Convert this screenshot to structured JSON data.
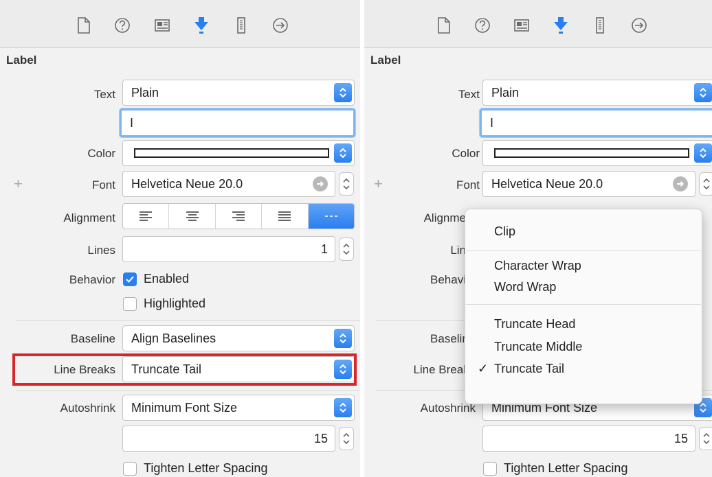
{
  "section_title": "Label",
  "labels": {
    "text": "Text",
    "color": "Color",
    "font": "Font",
    "alignment": "Alignment",
    "lines": "Lines",
    "behavior": "Behavior",
    "baseline": "Baseline",
    "line_breaks": "Line Breaks",
    "autoshrink": "Autoshrink"
  },
  "right_labels": {
    "text": "Text",
    "color": "Color",
    "font": "Font",
    "alignment": "Alignme",
    "lines": "Lin",
    "behavior": "Behavi",
    "baseline": "Baselir",
    "line_breaks": "Line Breal",
    "autoshrink": "Autoshrink"
  },
  "values": {
    "text_type": "Plain",
    "text_field": "I",
    "font": "Helvetica Neue 20.0",
    "lines": "1",
    "enabled": "Enabled",
    "highlighted": "Highlighted",
    "baseline": "Align Baselines",
    "line_breaks": "Truncate Tail",
    "autoshrink": "Minimum Font Size",
    "min_font_size": "15",
    "tighten": "Tighten Letter Spacing"
  },
  "state": {
    "enabled_checked": true,
    "highlighted_checked": false,
    "tighten_checked": false
  },
  "toolbar_icons": [
    "file-inspector-icon",
    "quick-help-icon",
    "identity-inspector-icon",
    "attributes-inspector-icon",
    "size-inspector-icon",
    "connections-inspector-icon"
  ],
  "line_break_menu": {
    "groups": [
      [
        "Clip"
      ],
      [
        "Character Wrap",
        "Word Wrap"
      ],
      [
        "Truncate Head",
        "Truncate Middle",
        "Truncate Tail"
      ]
    ],
    "selected": "Truncate Tail",
    "checkmark": "✓"
  },
  "colors": {
    "accent": "#2a7ff0",
    "highlight_box": "#d8262b",
    "panel_bg": "#f2f2f2"
  }
}
